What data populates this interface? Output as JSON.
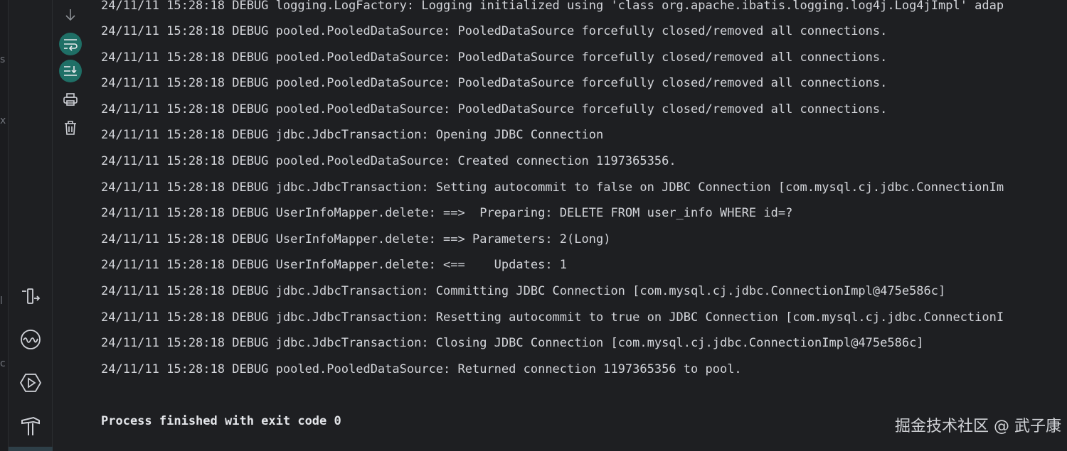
{
  "side_fragments": [
    "s",
    "x",
    "l",
    "c"
  ],
  "log_lines": [
    "24/11/11 15:28:18 DEBUG logging.LogFactory: Logging initialized using 'class org.apache.ibatis.logging.log4j.Log4jImpl' adap",
    "24/11/11 15:28:18 DEBUG pooled.PooledDataSource: PooledDataSource forcefully closed/removed all connections.",
    "24/11/11 15:28:18 DEBUG pooled.PooledDataSource: PooledDataSource forcefully closed/removed all connections.",
    "24/11/11 15:28:18 DEBUG pooled.PooledDataSource: PooledDataSource forcefully closed/removed all connections.",
    "24/11/11 15:28:18 DEBUG pooled.PooledDataSource: PooledDataSource forcefully closed/removed all connections.",
    "24/11/11 15:28:18 DEBUG jdbc.JdbcTransaction: Opening JDBC Connection",
    "24/11/11 15:28:18 DEBUG pooled.PooledDataSource: Created connection 1197365356.",
    "24/11/11 15:28:18 DEBUG jdbc.JdbcTransaction: Setting autocommit to false on JDBC Connection [com.mysql.cj.jdbc.ConnectionIm",
    "24/11/11 15:28:18 DEBUG UserInfoMapper.delete: ==>  Preparing: DELETE FROM user_info WHERE id=?",
    "24/11/11 15:28:18 DEBUG UserInfoMapper.delete: ==> Parameters: 2(Long)",
    "24/11/11 15:28:18 DEBUG UserInfoMapper.delete: <==    Updates: 1",
    "24/11/11 15:28:18 DEBUG jdbc.JdbcTransaction: Committing JDBC Connection [com.mysql.cj.jdbc.ConnectionImpl@475e586c]",
    "24/11/11 15:28:18 DEBUG jdbc.JdbcTransaction: Resetting autocommit to true on JDBC Connection [com.mysql.cj.jdbc.ConnectionI",
    "24/11/11 15:28:18 DEBUG jdbc.JdbcTransaction: Closing JDBC Connection [com.mysql.cj.jdbc.ConnectionImpl@475e586c]",
    "24/11/11 15:28:18 DEBUG pooled.PooledDataSource: Returned connection 1197365356 to pool."
  ],
  "exit_message": "Process finished with exit code 0",
  "watermark": "掘金技术社区 @ 武子康",
  "toolbar_icons": [
    "scroll-down-icon",
    "soft-wrap-icon",
    "scroll-to-end-icon",
    "print-icon",
    "trash-icon"
  ],
  "tool_strip_icons": [
    "run-exit-icon",
    "profiler-icon",
    "services-icon",
    "build-icon"
  ],
  "colors": {
    "background": "#1e1f22",
    "text": "#d3d5da",
    "toggle_accent": "#1f6f66"
  }
}
